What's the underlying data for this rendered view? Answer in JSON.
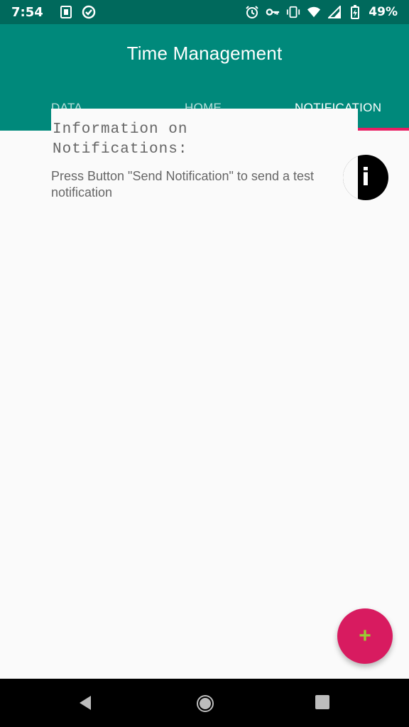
{
  "status_bar": {
    "time": "7:54",
    "battery_percent": "49%",
    "icons": [
      "sim-card-icon",
      "sync-icon",
      "alarm-icon",
      "vpn-key-icon",
      "vibrate-icon",
      "wifi-icon",
      "cellular-signal-icon",
      "battery-charging-icon"
    ]
  },
  "app_bar": {
    "title": "Time Management",
    "background_color": "#00897b",
    "status_color": "#00695c"
  },
  "tabs": [
    {
      "label": "DATA",
      "active": false
    },
    {
      "label": "HOME",
      "active": false
    },
    {
      "label": "NOTIFICATION",
      "active": true
    }
  ],
  "accent_color": "#e91e63",
  "info_card": {
    "heading": "Information on Notifications:",
    "body": "Press Button \"Send Notification\" to send a test notification"
  },
  "info_icon": "info-icon",
  "fab": {
    "icon": "plus-icon",
    "color": "#d81b60"
  },
  "nav_bar": {
    "buttons": [
      "back-icon",
      "home-icon",
      "recents-icon"
    ]
  }
}
